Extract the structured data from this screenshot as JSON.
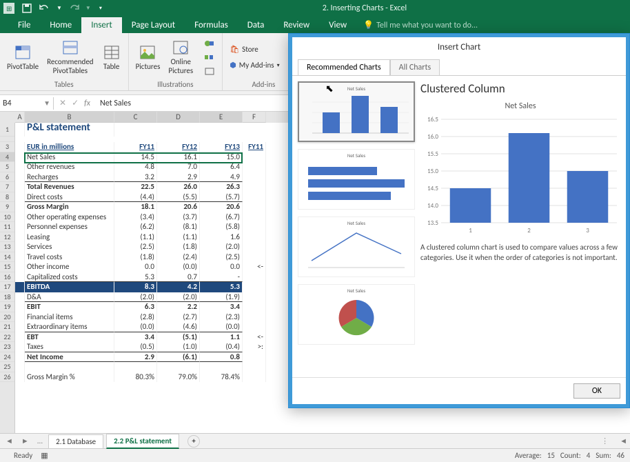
{
  "window": {
    "title": "2. Inserting Charts - Excel"
  },
  "qat": {
    "items": [
      "save",
      "undo",
      "redo"
    ]
  },
  "tabs": {
    "file": "File",
    "home": "Home",
    "insert": "Insert",
    "page_layout": "Page Layout",
    "formulas": "Formulas",
    "data": "Data",
    "review": "Review",
    "view": "View",
    "tell_me": "Tell me what you want to do..."
  },
  "ribbon": {
    "tables": {
      "pivot": "PivotTable",
      "recommended": "Recommended\nPivotTables",
      "table": "Table",
      "group": "Tables"
    },
    "illustrations": {
      "pictures": "Pictures",
      "online": "Online\nPictures",
      "group": "Illustrations"
    },
    "addins": {
      "store": "Store",
      "myaddins": "My Add-ins",
      "group": "Add-ins"
    }
  },
  "name_box": "B4",
  "formula_value": "Net Sales",
  "sheet_title": "P&L statement",
  "col_headers": [
    "A",
    "B",
    "C",
    "D",
    "E",
    "F"
  ],
  "headers": {
    "eur": "EUR in millions",
    "fy11": "FY11",
    "fy12": "FY12",
    "fy13": "FY13",
    "fy11f": "FY11"
  },
  "rows": [
    {
      "n": 4,
      "b": "Net Sales",
      "c": "14.5",
      "d": "16.1",
      "e": "15.0",
      "sel": true
    },
    {
      "n": 5,
      "b": "Other revenues",
      "c": "4.8",
      "d": "7.0",
      "e": "6.4"
    },
    {
      "n": 6,
      "b": "Recharges",
      "c": "3.2",
      "d": "2.9",
      "e": "4.9",
      "bb": true
    },
    {
      "n": 7,
      "b": "Total Revenues",
      "c": "22.5",
      "d": "26.0",
      "e": "26.3",
      "bold": true
    },
    {
      "n": 8,
      "b": "Direct costs",
      "c": "(4.4)",
      "d": "(5.5)",
      "e": "(5.7)",
      "bb": true
    },
    {
      "n": 9,
      "b": "Gross Margin",
      "c": "18.1",
      "d": "20.6",
      "e": "20.6",
      "bold": true
    },
    {
      "n": 10,
      "b": "Other operating expenses",
      "c": "(3.4)",
      "d": "(3.7)",
      "e": "(6.7)"
    },
    {
      "n": 11,
      "b": "Personnel expenses",
      "c": "(6.2)",
      "d": "(8.1)",
      "e": "(5.8)"
    },
    {
      "n": 12,
      "b": "Leasing",
      "c": "(1.1)",
      "d": "(1.1)",
      "e": "1.6"
    },
    {
      "n": 13,
      "b": "Services",
      "c": "(2.5)",
      "d": "(1.8)",
      "e": "(2.0)"
    },
    {
      "n": 14,
      "b": "Travel costs",
      "c": "(1.8)",
      "d": "(2.4)",
      "e": "(2.5)"
    },
    {
      "n": 15,
      "b": "Other income",
      "c": "0.0",
      "d": "(0.0)",
      "e": "0.0",
      "f": "<-"
    },
    {
      "n": 16,
      "b": "Capitalized costs",
      "c": "5.3",
      "d": "0.7",
      "e": "-",
      "bb": true
    },
    {
      "n": 17,
      "b": "EBITDA",
      "c": "8.3",
      "d": "4.2",
      "e": "5.3",
      "ebitda": true
    },
    {
      "n": 18,
      "b": "D&A",
      "c": "(2.0)",
      "d": "(2.0)",
      "e": "(1.9)",
      "bb": true
    },
    {
      "n": 19,
      "b": "EBIT",
      "c": "6.3",
      "d": "2.2",
      "e": "3.4",
      "bold": true
    },
    {
      "n": 20,
      "b": "Financial items",
      "c": "(2.8)",
      "d": "(2.7)",
      "e": "(2.3)"
    },
    {
      "n": 21,
      "b": "Extraordinary items",
      "c": "(0.0)",
      "d": "(4.6)",
      "e": "(0.0)",
      "bb": true
    },
    {
      "n": 22,
      "b": "EBT",
      "c": "3.4",
      "d": "(5.1)",
      "e": "1.1",
      "bold": true,
      "f": "<-"
    },
    {
      "n": 23,
      "b": "Taxes",
      "c": "(0.5)",
      "d": "(1.0)",
      "e": "(0.4)",
      "bb": true,
      "f": ">:"
    },
    {
      "n": 24,
      "b": "Net Income",
      "c": "2.9",
      "d": "(6.1)",
      "e": "0.8",
      "bold": true,
      "bb": true
    },
    {
      "n": 25,
      "b": "",
      "c": "",
      "d": "",
      "e": ""
    },
    {
      "n": 26,
      "b": "Gross Margin %",
      "c": "80.3%",
      "d": "79.0%",
      "e": "78.4%"
    }
  ],
  "sheet_tabs": {
    "prev": "...",
    "db": "2.1 Database",
    "pl": "2.2 P&L statement"
  },
  "status": {
    "ready": "Ready",
    "avg_lbl": "Average:",
    "avg": "15",
    "cnt_lbl": "Count:",
    "cnt": "4",
    "sum_lbl": "Sum:",
    "sum": "46"
  },
  "dialog": {
    "title": "Insert Chart",
    "tab_rec": "Recommended Charts",
    "tab_all": "All Charts",
    "thumb_title": "Net Sales",
    "preview_title": "Clustered Column",
    "chart_title": "Net Sales",
    "desc": "A clustered column chart is used to compare values across a few categories. Use it when the order of categories is not important.",
    "ok": "OK"
  },
  "chart_data": {
    "type": "bar",
    "title": "Net Sales",
    "categories": [
      "1",
      "2",
      "3"
    ],
    "values": [
      14.5,
      16.1,
      15.0
    ],
    "ylim": [
      13.5,
      16.5
    ],
    "yticks": [
      13.5,
      14.0,
      14.5,
      15.0,
      15.5,
      16.0,
      16.5
    ],
    "xlabel": "",
    "ylabel": ""
  }
}
